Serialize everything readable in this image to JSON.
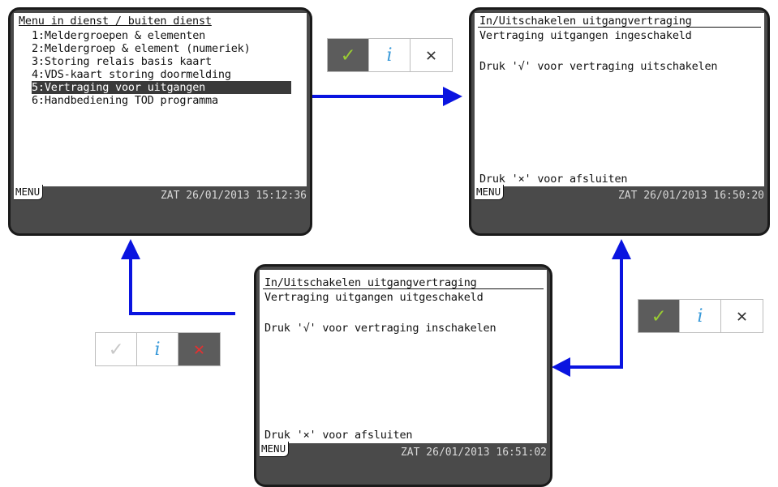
{
  "colors": {
    "arrow": "#0a14e0",
    "check_active": "#9acd32",
    "check_inactive": "#c8c8c8",
    "info": "#3a9ad9",
    "x_active": "#e53030",
    "x_inactive": "#333333"
  },
  "screen1": {
    "title": "Menu in dienst / buiten dienst",
    "items": [
      "1:Meldergroepen & elementen",
      "2:Meldergroep & element (numeriek)",
      "3:Storing relais basis kaart",
      "4:VDS-kaart storing doormelding",
      "5:Vertraging voor uitgangen",
      "6:Handbediening TOD programma"
    ],
    "menu_tab": "MENU",
    "clock": "ZAT 26/01/2013 15:12:36"
  },
  "screen2": {
    "title": "In/Uitschakelen uitgangvertraging",
    "status_line": "Vertraging uitgangen ingeschakeld",
    "instruction": "Druk '√' voor vertraging uitschakelen",
    "footer": "Druk '×' voor afsluiten",
    "menu_tab": "MENU",
    "clock": "ZAT 26/01/2013 16:50:20"
  },
  "screen3": {
    "title": "In/Uitschakelen uitgangvertraging",
    "status_line": "Vertraging uitgangen uitgeschakeld",
    "instruction": "Druk '√' voor vertraging inschakelen",
    "footer": "Druk '×' voor afsluiten",
    "menu_tab": "MENU",
    "clock": "ZAT 26/01/2013 16:51:02"
  },
  "keypads": {
    "check_glyph": "✓",
    "info_glyph": "i",
    "close_glyph": "✕"
  }
}
